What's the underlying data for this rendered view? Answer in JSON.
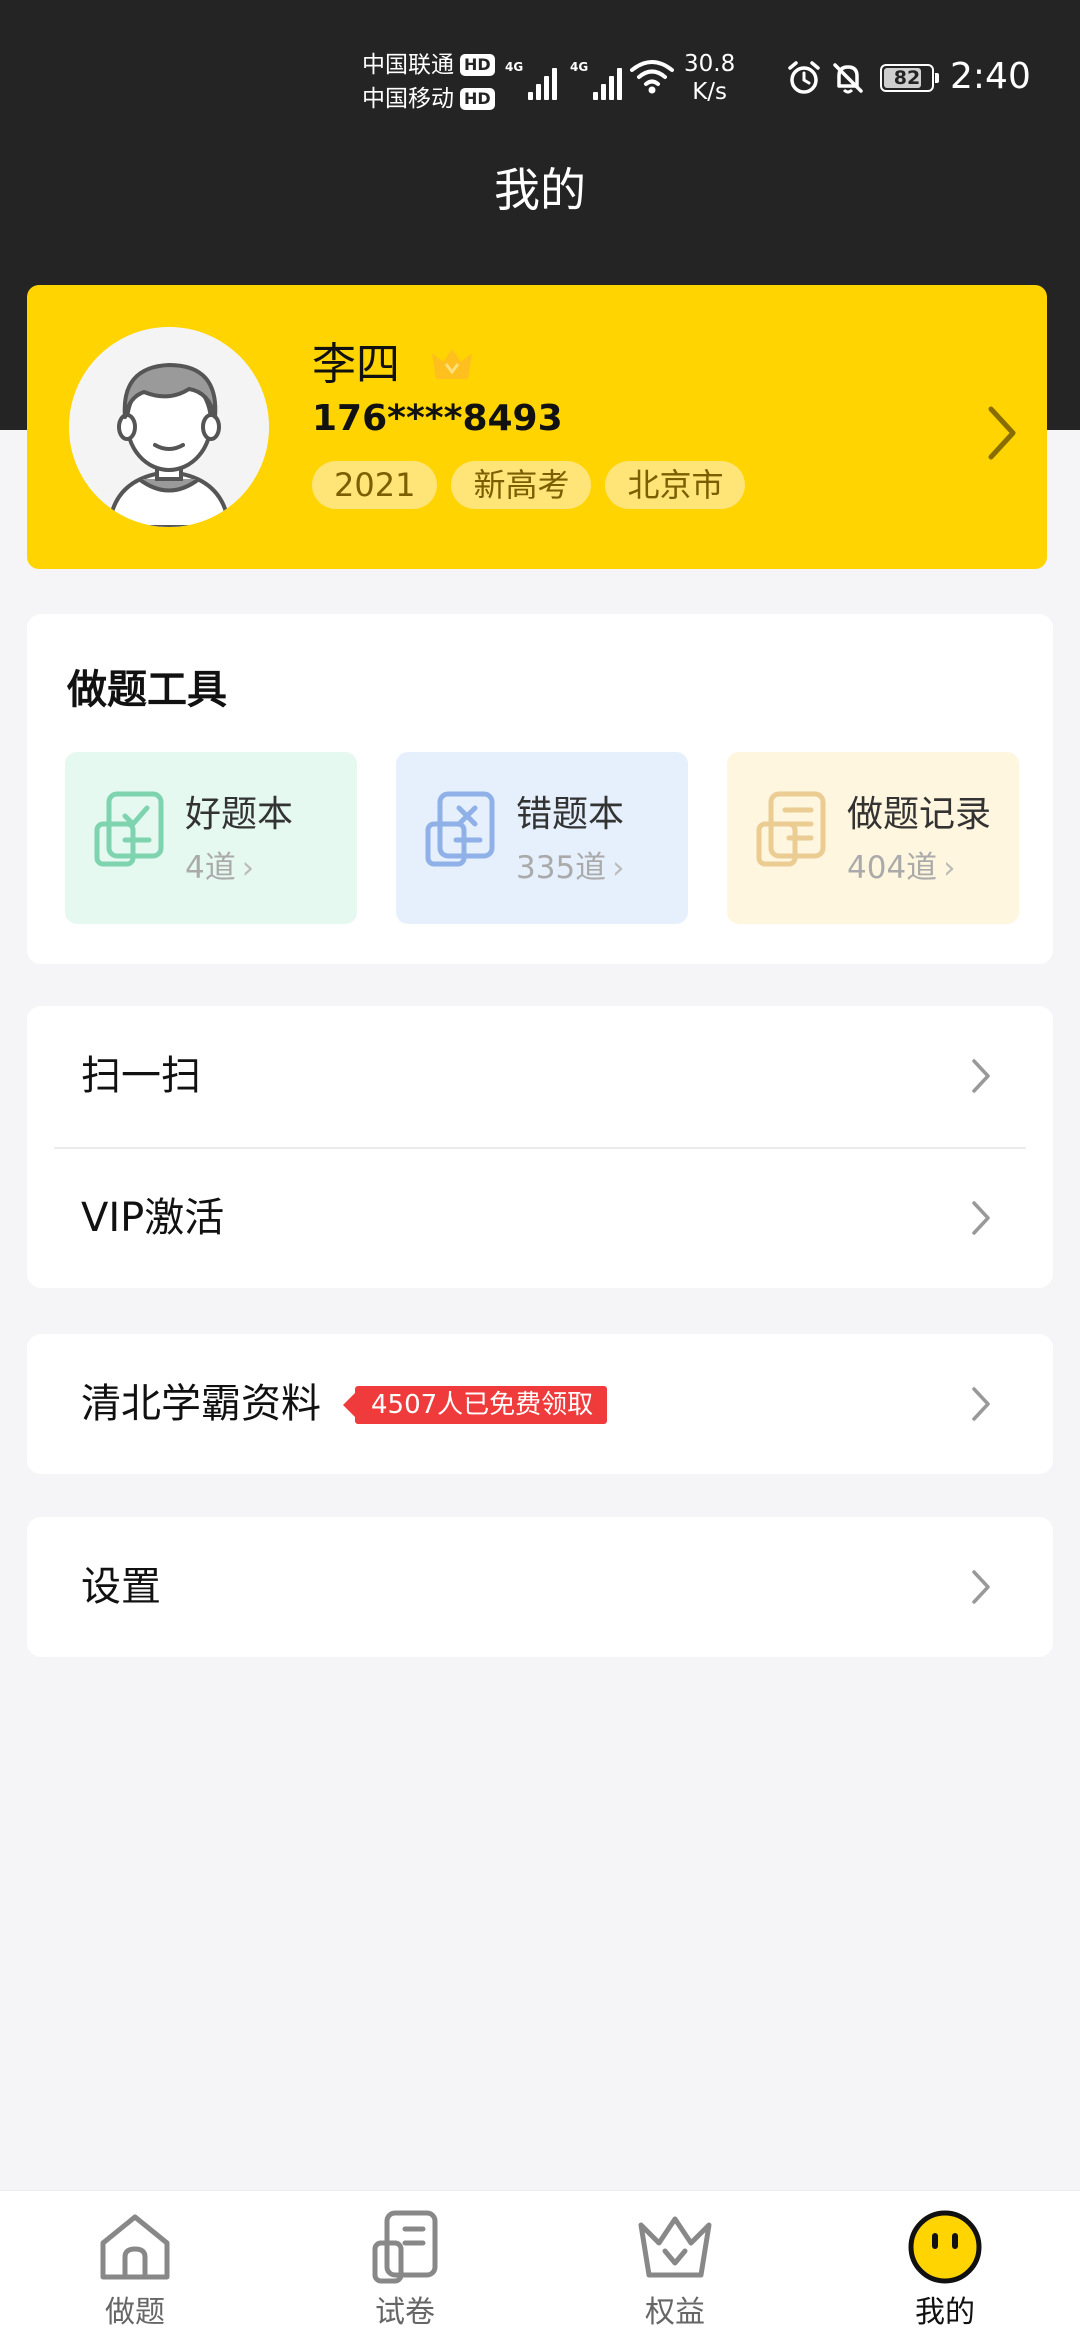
{
  "status_bar": {
    "carrier1": "中国联通",
    "carrier2": "中国移动",
    "hd_label": "HD",
    "network1": "4G",
    "network2": "4G",
    "speed_value": "30.8",
    "speed_unit": "K/s",
    "battery": "82",
    "battery_level": 0.82,
    "time": "2:40"
  },
  "header": {
    "title": "我的"
  },
  "profile": {
    "name": "李四",
    "phone": "176****8493",
    "tags": [
      "2021",
      "新高考",
      "北京市"
    ]
  },
  "tools": {
    "title": "做题工具",
    "items": [
      {
        "name": "好题本",
        "count": "4道",
        "icon": "checklist-icon",
        "bg": "#e6f9f1",
        "color": "#7fd4b0"
      },
      {
        "name": "错题本",
        "count": "335道",
        "icon": "wrong-sheet-icon",
        "bg": "#e6f0fc",
        "color": "#8fb1e8"
      },
      {
        "name": "做题记录",
        "count": "404道",
        "icon": "record-icon",
        "bg": "#fff6df",
        "color": "#ebcc93"
      }
    ]
  },
  "menu": {
    "scan": "扫一扫",
    "vip": "VIP激活",
    "materials": "清北学霸资料",
    "materials_badge": "4507人已免费领取",
    "settings": "设置"
  },
  "nav": {
    "items": [
      {
        "label": "做题",
        "icon": "home-icon"
      },
      {
        "label": "试卷",
        "icon": "paper-icon"
      },
      {
        "label": "权益",
        "icon": "crown-icon"
      },
      {
        "label": "我的",
        "icon": "smiley-icon",
        "active": true
      }
    ]
  },
  "colors": {
    "accent": "#ffd400",
    "header_bg": "#242424",
    "badge_red": "#ef3b3b"
  }
}
